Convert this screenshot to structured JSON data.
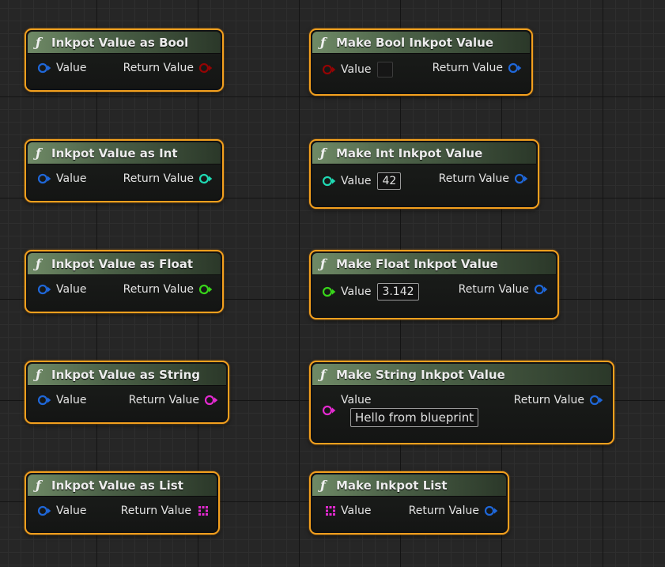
{
  "nodes": {
    "as_bool": {
      "title": "Inkpot Value as Bool",
      "in_label": "Value",
      "out_label": "Return Value"
    },
    "as_int": {
      "title": "Inkpot Value as Int",
      "in_label": "Value",
      "out_label": "Return Value"
    },
    "as_float": {
      "title": "Inkpot Value as Float",
      "in_label": "Value",
      "out_label": "Return Value"
    },
    "as_string": {
      "title": "Inkpot Value as String",
      "in_label": "Value",
      "out_label": "Return Value"
    },
    "as_list": {
      "title": "Inkpot Value as List",
      "in_label": "Value",
      "out_label": "Return Value"
    },
    "make_bool": {
      "title": "Make Bool Inkpot Value",
      "in_label": "Value",
      "out_label": "Return Value",
      "default": ""
    },
    "make_int": {
      "title": "Make Int Inkpot Value",
      "in_label": "Value",
      "out_label": "Return Value",
      "default": "42"
    },
    "make_float": {
      "title": "Make Float Inkpot Value",
      "in_label": "Value",
      "out_label": "Return Value",
      "default": "3.142"
    },
    "make_string": {
      "title": "Make String Inkpot Value",
      "in_label": "Value",
      "out_label": "Return Value",
      "default": "Hello from blueprint"
    },
    "make_list": {
      "title": "Make Inkpot List",
      "in_label": "Value",
      "out_label": "Return Value"
    }
  },
  "icons": {
    "function": "function-icon",
    "struct_pin": "struct-pin-icon",
    "bool_pin": "bool-pin-icon",
    "int_pin": "int-pin-icon",
    "float_pin": "float-pin-icon",
    "string_pin": "string-pin-icon",
    "array_pin": "array-pin-icon"
  },
  "colors": {
    "node_border": "#f3a01e",
    "header": "#6f8a66",
    "struct_pin": "#1f67d8",
    "bool_pin": "#930404",
    "int_pin": "#1fd9b3",
    "float_pin": "#38d51a",
    "string_pin": "#e32ad0",
    "array_pin": "#e32ad0"
  }
}
